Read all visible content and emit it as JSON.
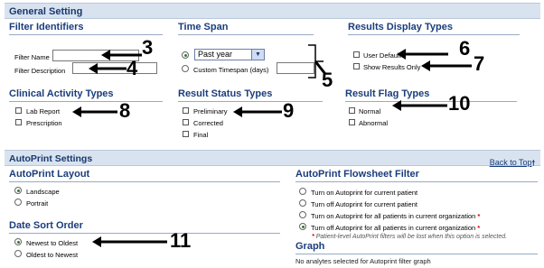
{
  "general": {
    "title": "General Setting"
  },
  "filter_identifiers": {
    "title": "Filter Identifiers",
    "name_label": "Filter Name",
    "name_value": "",
    "description_label": "Filter Description",
    "description_value": ""
  },
  "time_span": {
    "title": "Time Span",
    "select_value": "Past year",
    "custom_label": "Custom Timespan (days)",
    "custom_value": ""
  },
  "results_display": {
    "title": "Results Display Types",
    "items": [
      "User Default",
      "Show Results Only"
    ]
  },
  "clinical_activity": {
    "title": "Clinical Activity Types",
    "items": [
      "Lab Report",
      "Prescription"
    ]
  },
  "result_status": {
    "title": "Result Status Types",
    "items": [
      "Preliminary",
      "Corrected",
      "Final"
    ]
  },
  "result_flag": {
    "title": "Result Flag Types",
    "items": [
      "Normal",
      "Abnormal"
    ]
  },
  "autoprint": {
    "title": "AutoPrint Settings",
    "back_to_top": "Back to Top",
    "back_icon": "arrow-up-icon",
    "layout": {
      "title": "AutoPrint Layout",
      "options": [
        "Landscape",
        "Portrait"
      ],
      "selected": 0
    },
    "date_sort": {
      "title": "Date Sort Order",
      "options": [
        "Newest to Oldest",
        "Oldest to Newest"
      ],
      "selected": 0
    },
    "flowsheet": {
      "title": "AutoPrint Flowsheet Filter",
      "options": [
        "Turn on Autoprint for current patient",
        "Turn off Autoprint for current patient",
        "Turn on Autoprint for all patients in current organization",
        "Turn off Autoprint for all patients in current organization"
      ],
      "selected": 3,
      "asterisk": "*",
      "note": "Patient-level AutoPrint filters will be lost when this option is selected."
    },
    "graph": {
      "title": "Graph",
      "text": "No analytes selected for Autoprint filter graph"
    }
  },
  "callouts": [
    "3",
    "4",
    "5",
    "6",
    "7",
    "8",
    "9",
    "10",
    "11"
  ]
}
